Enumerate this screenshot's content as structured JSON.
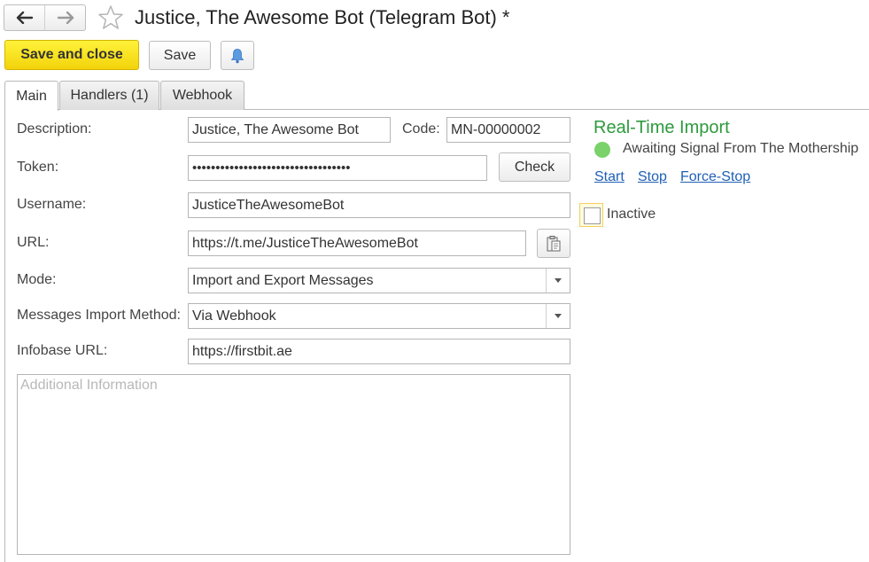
{
  "header": {
    "title": "Justice, The Awesome Bot (Telegram Bot) *",
    "back_icon": "arrow-left-icon",
    "forward_icon": "arrow-right-icon",
    "favorite_icon": "star-icon"
  },
  "toolbar": {
    "save_close_label": "Save and close",
    "save_label": "Save",
    "notify_icon": "bell-icon"
  },
  "tabs": [
    {
      "label": "Main",
      "active": true
    },
    {
      "label": "Handlers (1)",
      "active": false
    },
    {
      "label": "Webhook",
      "active": false
    }
  ],
  "form": {
    "description": {
      "label": "Description:",
      "value": "Justice, The Awesome Bot"
    },
    "code": {
      "label": "Code:",
      "value": "MN-00000002"
    },
    "token": {
      "label": "Token:",
      "value": "••••••••••••••••••••••••••••••••••"
    },
    "check_label": "Check",
    "username": {
      "label": "Username:",
      "value": "JusticeTheAwesomeBot"
    },
    "url": {
      "label": "URL:",
      "value": "https://t.me/JusticeTheAwesomeBot",
      "copy_icon": "clipboard-icon"
    },
    "mode": {
      "label": "Mode:",
      "value": "Import and Export Messages"
    },
    "import_method": {
      "label": "Messages Import Method:",
      "value": "Via Webhook"
    },
    "infobase_url": {
      "label": "Infobase URL:",
      "value": "https://firstbit.ae"
    },
    "additional_info": {
      "placeholder": "Additional Information",
      "value": ""
    }
  },
  "realtime": {
    "title": "Real-Time Import",
    "status_text": "Awaiting Signal From The Mothership",
    "status_color": "#7bd26b",
    "links": [
      "Start",
      "Stop",
      "Force-Stop"
    ]
  },
  "inactive": {
    "label": "Inactive",
    "checked": false
  },
  "colors": {
    "primary_button": "#f5d80f",
    "title_green": "#2e9a3e",
    "link_blue": "#1f5fb6"
  }
}
